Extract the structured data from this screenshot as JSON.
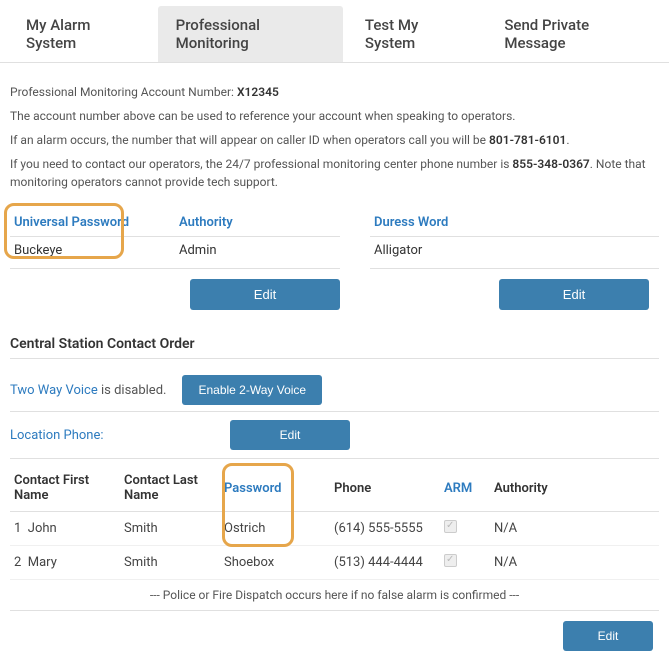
{
  "tabs": {
    "items": [
      "My Alarm System",
      "Professional Monitoring",
      "Test My System",
      "Send Private Message"
    ]
  },
  "intro": {
    "acct_label": "Professional Monitoring Account Number: ",
    "acct_number": "X12345",
    "line2": "The account number above can be used to reference your account when speaking to operators.",
    "line3a": "If an alarm occurs, the number that will appear on caller ID when operators call you will be ",
    "line3b": "801-781-6101",
    "line3c": ".",
    "line4a": "If you need to contact our operators, the 24/7 professional monitoring center phone number is ",
    "line4b": "855-348-0367",
    "line4c": ". Note that monitoring operators cannot provide tech support."
  },
  "passwords": {
    "universal_label": "Universal Password",
    "universal_value": "Buckeye",
    "authority_label": "Authority",
    "authority_value": "Admin",
    "duress_label": "Duress Word",
    "duress_value": "Alligator",
    "edit": "Edit"
  },
  "central": {
    "title": "Central Station Contact Order",
    "two_way_label": "Two Way Voice",
    "two_way_suffix": " is disabled.",
    "enable_btn": "Enable 2-Way Voice",
    "location_phone_label": "Location Phone:",
    "edit": "Edit"
  },
  "contacts": {
    "headers": {
      "first": "Contact First Name",
      "last": "Contact Last Name",
      "password": "Password",
      "phone": "Phone",
      "arm": "ARM",
      "authority": "Authority"
    },
    "rows": [
      {
        "idx": "1",
        "first": "John",
        "last": "Smith",
        "password": "Ostrich",
        "phone": "(614) 555-5555",
        "authority": "N/A"
      },
      {
        "idx": "2",
        "first": "Mary",
        "last": "Smith",
        "password": "Shoebox",
        "phone": "(513) 444-4444",
        "authority": "N/A"
      }
    ],
    "footnote": "--- Police or Fire Dispatch occurs here if no false alarm is confirmed ---",
    "edit": "Edit"
  }
}
